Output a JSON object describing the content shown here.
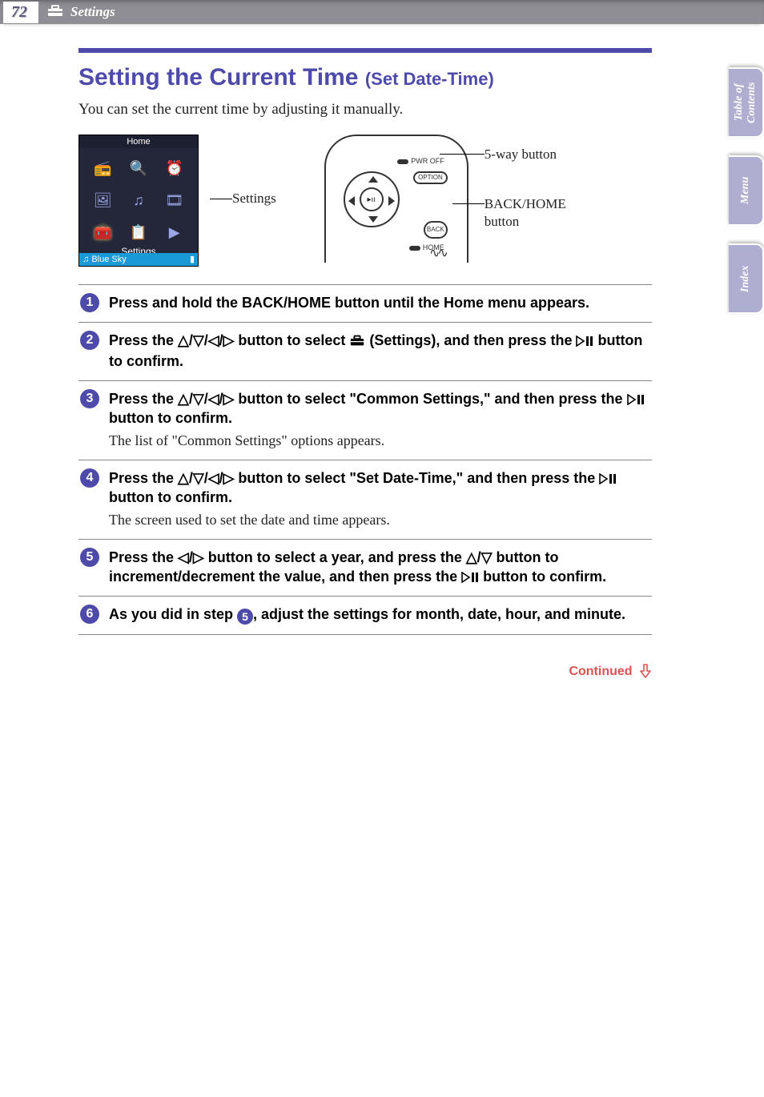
{
  "header": {
    "page_number": "72",
    "chapter": "Settings"
  },
  "title_main": "Setting the Current Time",
  "title_sub": "(Set Date-Time)",
  "intro": "You can set the current time by adjusting it manually.",
  "home_screen": {
    "title": "Home",
    "selected_label": "Settings",
    "now_playing_prefix": "♫",
    "now_playing": "Blue Sky"
  },
  "settings_callout": "Settings",
  "device": {
    "pwr_off": "PWR OFF",
    "option": "OPTION",
    "back": "BACK",
    "home": "HOME",
    "play": "▸ıı"
  },
  "device_callouts": {
    "five_way": "5-way button",
    "back_home_line1": "BACK/HOME",
    "back_home_line2": "button"
  },
  "steps": [
    {
      "n": "1",
      "bold": "Press and hold the BACK/HOME button until the Home menu appears."
    },
    {
      "n": "2",
      "bold_pre": "Press the ",
      "bold_mid": " button to select ",
      "bold_mid2": " (Settings), and then press the ",
      "bold_end": " button to confirm.",
      "has_dirs": true,
      "has_toolbox": true,
      "has_play": true
    },
    {
      "n": "3",
      "bold_pre": "Press the ",
      "bold_mid": " button to select \"Common Settings,\" and then press the ",
      "bold_end": " button to confirm.",
      "has_dirs": true,
      "has_play": true,
      "sub": "The list of \"Common Settings\" options appears."
    },
    {
      "n": "4",
      "bold_pre": "Press the ",
      "bold_mid": " button to select \"Set Date-Time,\" and then press the ",
      "bold_end": " button to confirm.",
      "has_dirs": true,
      "has_play": true,
      "sub": "The screen used to set the date and time appears."
    },
    {
      "n": "5",
      "bold_pre": "Press the ",
      "bold_lr": " button to select a year, and press the ",
      "bold_ud": " button to increment/decrement the value, and then press the ",
      "bold_end": " button to confirm.",
      "has_lr": true,
      "has_ud": true,
      "has_play": true
    },
    {
      "n": "6",
      "bold_pre": "As you did in step ",
      "ref": "5",
      "bold_end": ", adjust the settings for month, date, hour, and minute."
    }
  ],
  "continued": "Continued",
  "side_tabs": [
    "Table of Contents",
    "Menu",
    "Index"
  ]
}
